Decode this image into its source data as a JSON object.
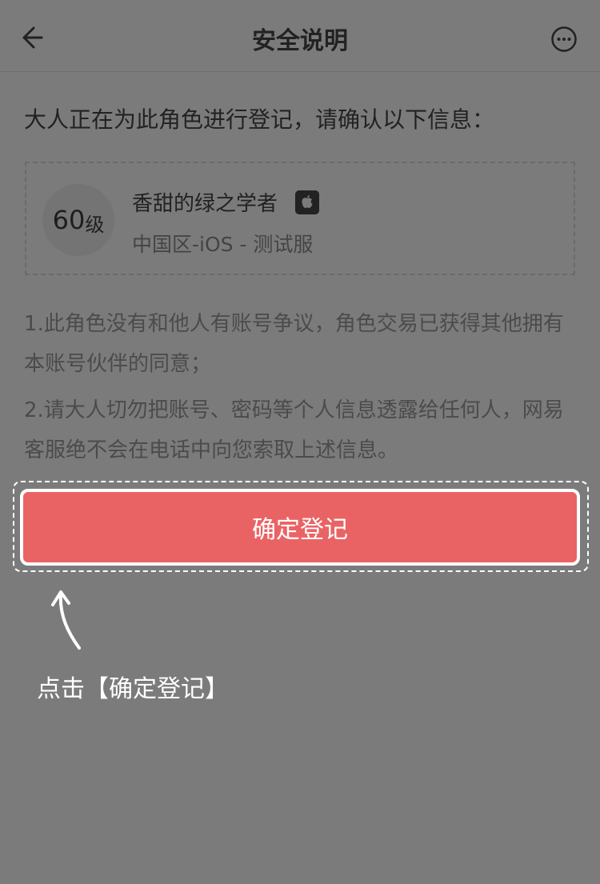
{
  "header": {
    "title": "安全说明",
    "back_icon": "arrow-left-icon",
    "more_icon": "more-circle-icon"
  },
  "intro": "大人正在为此角色进行登记，请确认以下信息：",
  "role": {
    "level_number": "60",
    "level_unit": "级",
    "name": "香甜的绿之学者",
    "platform_icon": "apple-icon",
    "server": "中国区-iOS - 测试服"
  },
  "notes": [
    "1.此角色没有和他人有账号争议，角色交易已获得其他拥有本账号伙伴的同意；",
    "2.请大人切勿把账号、密码等个人信息透露给任何人，网易客服绝不会在电话中向您索取上述信息。"
  ],
  "confirm_button": "确定登记",
  "hint": "点击【确定登记】",
  "colors": {
    "overlay": "#7b7b7b",
    "button": "#ea6364",
    "hint": "#ffffff"
  }
}
